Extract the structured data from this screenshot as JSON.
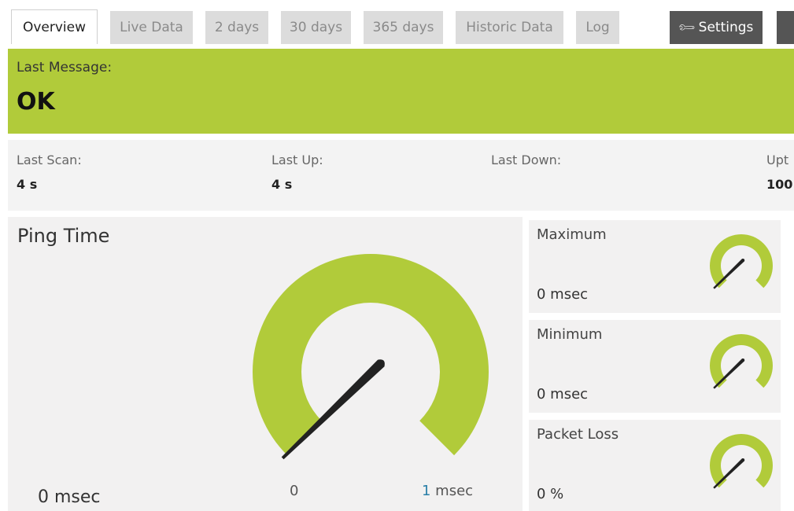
{
  "tabs": [
    {
      "label": "Overview"
    },
    {
      "label": "Live Data"
    },
    {
      "label": "2 days"
    },
    {
      "label": "30 days"
    },
    {
      "label": "365 days"
    },
    {
      "label": "Historic Data"
    },
    {
      "label": "Log"
    },
    {
      "label": "Settings",
      "icon": "wrench-icon"
    }
  ],
  "active_tab": "Overview",
  "status": {
    "label": "Last Message:",
    "value": "OK",
    "color": "#b1cb3a"
  },
  "stats": {
    "last_scan": {
      "label": "Last Scan:",
      "value": "4 s"
    },
    "last_up": {
      "label": "Last Up:",
      "value": "4 s"
    },
    "last_down": {
      "label": "Last Down:",
      "value": ""
    },
    "uptime": {
      "label": "Upt",
      "value": "100"
    }
  },
  "ping_time": {
    "title": "Ping Time",
    "value": "0 msec",
    "scale_min": "0",
    "scale_max_num": "1",
    "scale_max_unit": " msec",
    "needle_level": 0,
    "gauge_color": "#b1cb3a"
  },
  "channels": [
    {
      "title": "Maximum",
      "value": "0 msec",
      "needle_level": 0
    },
    {
      "title": "Minimum",
      "value": "0 msec",
      "needle_level": 0
    },
    {
      "title": "Packet Loss",
      "value": "0 %",
      "needle_level": 0
    }
  ]
}
